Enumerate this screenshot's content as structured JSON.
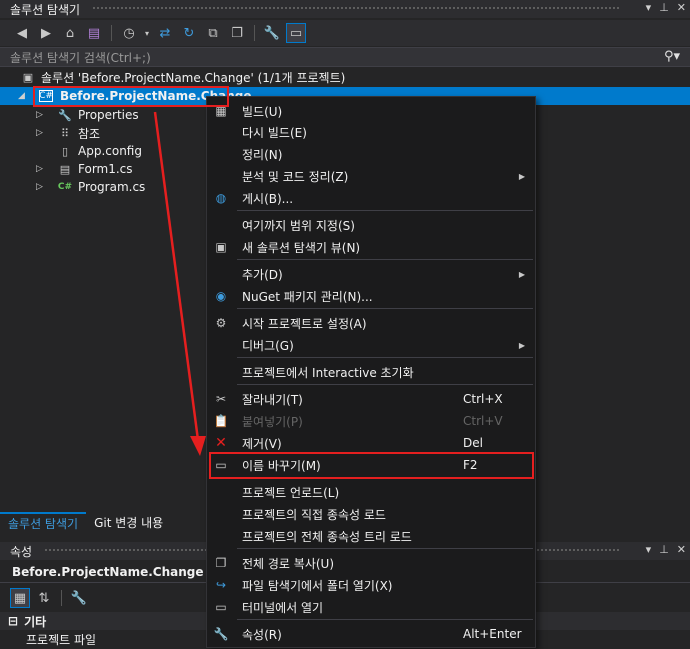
{
  "window": {
    "title": "솔루션 탐색기",
    "title_buttons": [
      "▾",
      "⊥",
      "✕"
    ]
  },
  "toolbar": {
    "icons": [
      "back-icon",
      "forward-icon",
      "home-icon",
      "vs-switch-icon",
      "history-icon",
      "sync-icon",
      "refresh-icon",
      "collapse-all-icon",
      "show-all-files-icon",
      "properties-wrench-icon",
      "preview-icon"
    ]
  },
  "search": {
    "placeholder": "솔루션 탐색기 검색(Ctrl+;)"
  },
  "tree": {
    "solution_label": "솔루션 'Before.ProjectName.Change' (1/1개 프로젝트)",
    "project_label": "Before.ProjectName.Change",
    "items": [
      "Properties",
      "참조",
      "App.config",
      "Form1.cs",
      "Program.cs"
    ]
  },
  "panel_tabs": {
    "tab1": "솔루션 탐색기",
    "tab2": "Git 변경 내용"
  },
  "properties": {
    "title": "속성",
    "object": "Before.ProjectName.Change  프로",
    "category": "기타",
    "row_label": "프로젝트 파일"
  },
  "context_menu": {
    "items": [
      {
        "label": "빌드(U)",
        "shortcut": ""
      },
      {
        "label": "다시 빌드(E)",
        "shortcut": ""
      },
      {
        "label": "정리(N)",
        "shortcut": ""
      },
      {
        "label": "분석 및 코드 정리(Z)",
        "shortcut": ""
      },
      {
        "label": "게시(B)...",
        "shortcut": ""
      },
      {
        "label": "여기까지 범위 지정(S)",
        "shortcut": ""
      },
      {
        "label": "새 솔루션 탐색기 뷰(N)",
        "shortcut": ""
      },
      {
        "label": "추가(D)",
        "shortcut": ""
      },
      {
        "label": "NuGet 패키지 관리(N)...",
        "shortcut": ""
      },
      {
        "label": "시작 프로젝트로 설정(A)",
        "shortcut": ""
      },
      {
        "label": "디버그(G)",
        "shortcut": ""
      },
      {
        "label": "프로젝트에서 Interactive 초기화",
        "shortcut": ""
      },
      {
        "label": "잘라내기(T)",
        "shortcut": "Ctrl+X"
      },
      {
        "label": "붙여넣기(P)",
        "shortcut": "Ctrl+V"
      },
      {
        "label": "제거(V)",
        "shortcut": "Del"
      },
      {
        "label": "이름 바꾸기(M)",
        "shortcut": "F2"
      },
      {
        "label": "프로젝트 언로드(L)",
        "shortcut": ""
      },
      {
        "label": "프로젝트의 직접 종속성 로드",
        "shortcut": ""
      },
      {
        "label": "프로젝트의 전체 종속성 트리 로드",
        "shortcut": ""
      },
      {
        "label": "전체 경로 복사(U)",
        "shortcut": ""
      },
      {
        "label": "파일 탐색기에서 폴더 열기(X)",
        "shortcut": ""
      },
      {
        "label": "터미널에서 열기",
        "shortcut": ""
      },
      {
        "label": "속성(R)",
        "shortcut": "Alt+Enter"
      }
    ]
  },
  "colors": {
    "accent": "#007acc",
    "highlight_red": "#e51f1f",
    "menu_bg": "#1b1b1c"
  }
}
